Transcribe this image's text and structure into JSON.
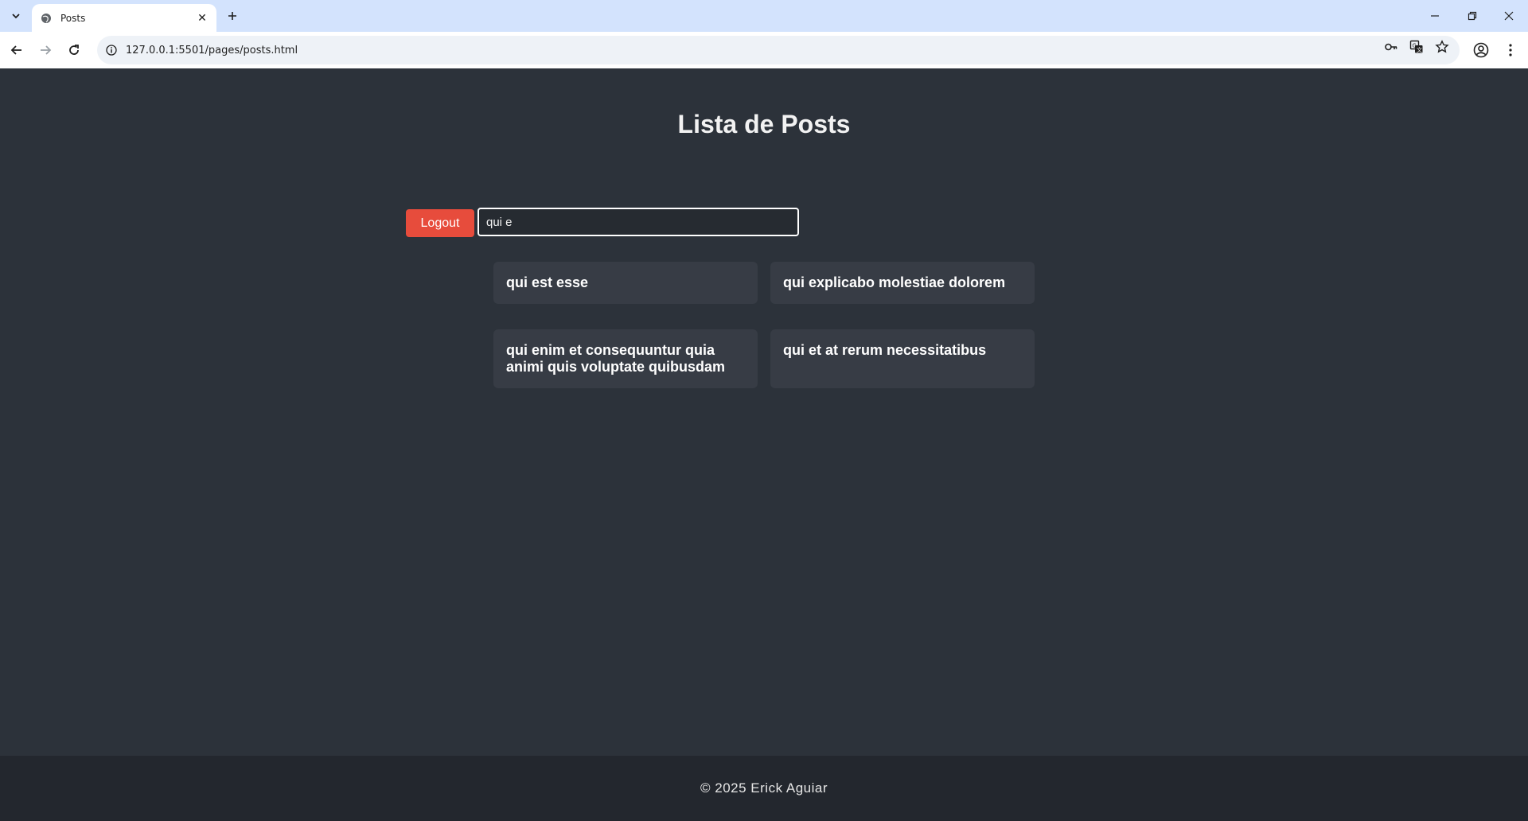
{
  "browser": {
    "tab_title": "Posts",
    "url": "127.0.0.1:5501/pages/posts.html"
  },
  "page": {
    "title": "Lista de Posts",
    "logout_label": "Logout",
    "search_value": "qui e"
  },
  "posts": [
    {
      "title": "qui est esse"
    },
    {
      "title": "qui explicabo molestiae dolorem"
    },
    {
      "title": "qui enim et consequuntur quia animi quis voluptate quibusdam"
    },
    {
      "title": "qui et at rerum necessitatibus"
    }
  ],
  "footer": {
    "text": "© 2025 Erick Aguiar"
  },
  "colors": {
    "page_bg": "#2c323a",
    "card_bg": "#373c45",
    "logout_bg": "#e74c3c",
    "footer_bg": "#23272e"
  }
}
